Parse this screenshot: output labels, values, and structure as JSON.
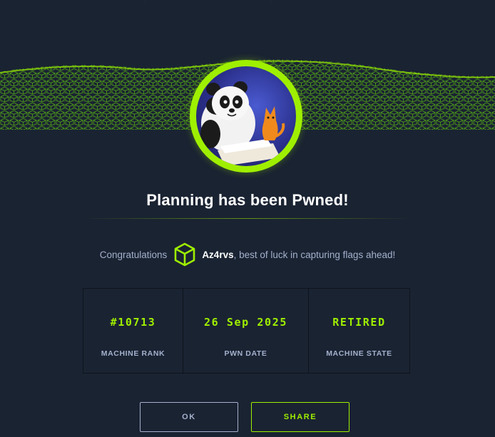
{
  "title": "Planning has been Pwned!",
  "congrats": {
    "prefix": "Congratulations",
    "username": "Az4rvs",
    "suffix": ", best of luck in capturing flags ahead!",
    "icon": "user-cube-icon"
  },
  "stats": [
    {
      "value": "#10713",
      "label": "MACHINE RANK"
    },
    {
      "value": "26 Sep 2025",
      "label": "PWN DATE"
    },
    {
      "value": "RETIRED",
      "label": "MACHINE STATE"
    }
  ],
  "buttons": {
    "ok": "OK",
    "share": "SHARE"
  },
  "colors": {
    "background": "#1a2332",
    "accent": "#9fef00",
    "muted": "#a4b1cd",
    "border": "#0e141e"
  }
}
